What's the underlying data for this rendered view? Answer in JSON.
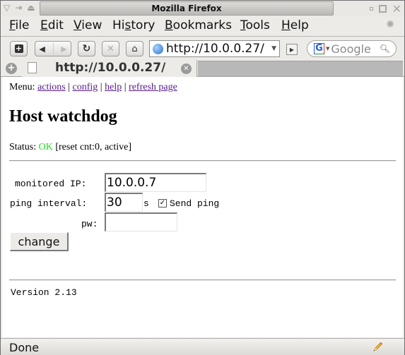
{
  "window": {
    "title": "Mozilla Firefox"
  },
  "menubar": {
    "items": [
      {
        "label": "File",
        "accel": "F"
      },
      {
        "label": "Edit",
        "accel": "E"
      },
      {
        "label": "View",
        "accel": "V"
      },
      {
        "label": "History",
        "accel": "s"
      },
      {
        "label": "Bookmarks",
        "accel": "B"
      },
      {
        "label": "Tools",
        "accel": "T"
      },
      {
        "label": "Help",
        "accel": "H"
      }
    ]
  },
  "navbar": {
    "url": "http://10.0.0.27/",
    "search_placeholder": "Google",
    "search_engine_letter": "G"
  },
  "tabs": [
    {
      "title": "http://10.0.0.27/",
      "active": true
    }
  ],
  "page": {
    "menu_prefix": "Menu:",
    "menu_links": [
      "actions",
      "config",
      "help",
      "refresh page"
    ],
    "menu_separator": "|",
    "title": "Host watchdog",
    "status_label": "Status:",
    "status_value": "OK",
    "status_detail": "[reset cnt:0, active]",
    "status_color": "#22dd22",
    "form": {
      "monitored_ip_label": "monitored IP:",
      "monitored_ip_value": "10.0.0.7",
      "ping_interval_label": "ping interval:",
      "ping_interval_value": "30",
      "ping_interval_unit": "s",
      "send_ping_label": "Send ping",
      "send_ping_checked": true,
      "pw_label": "pw:",
      "pw_value": "",
      "submit_label": "change"
    },
    "version": "Version 2.13"
  },
  "statusbar": {
    "text": "Done"
  },
  "colors": {
    "link": "#551a8b",
    "status_ok": "#22dd22"
  }
}
